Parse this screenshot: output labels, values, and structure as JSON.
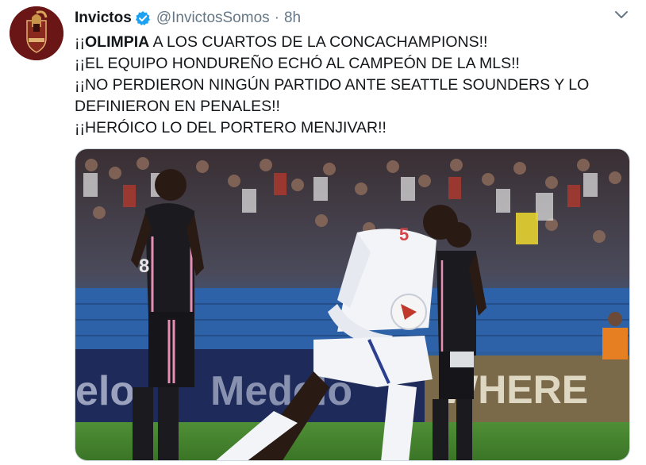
{
  "tweet": {
    "display_name": "Invictos",
    "handle": "@InvictosSomos",
    "separator": "·",
    "time": "8h",
    "text_lines": [
      {
        "pre": "¡¡",
        "bold": "OLIMPIA",
        "post": " A LOS CUARTOS DE LA CONCACHAMPIONS!!"
      },
      {
        "text": "¡¡EL EQUIPO HONDUREÑO ECHÓ AL CAMPEÓN DE LA MLS!!"
      },
      {
        "text": "¡¡NO PERDIERON NINGÚN PARTIDO ANTE SEATTLE SOUNDERS Y LO"
      },
      {
        "text": "DEFINIERON EN PENALES!!"
      },
      {
        "text": "¡¡HERÓICO LO DEL PORTERO MENJIVAR!!"
      }
    ]
  },
  "media": {
    "banner_texts": [
      "elo",
      "Medelo",
      "WHERE"
    ],
    "player_numbers": [
      "8",
      "5"
    ],
    "colors": {
      "sky": "#2a2f3a",
      "pitch": "#3e7f2c",
      "white_kit": "#f2f4f8",
      "black_kit": "#1a1a1f",
      "pink_trim": "#e58fb5"
    }
  },
  "icons": {
    "verified": "verified-badge-icon",
    "caret": "chevron-down-icon"
  },
  "colors": {
    "accent": "#1da1f2",
    "secondary_text": "#657786",
    "primary_text": "#14171a"
  }
}
